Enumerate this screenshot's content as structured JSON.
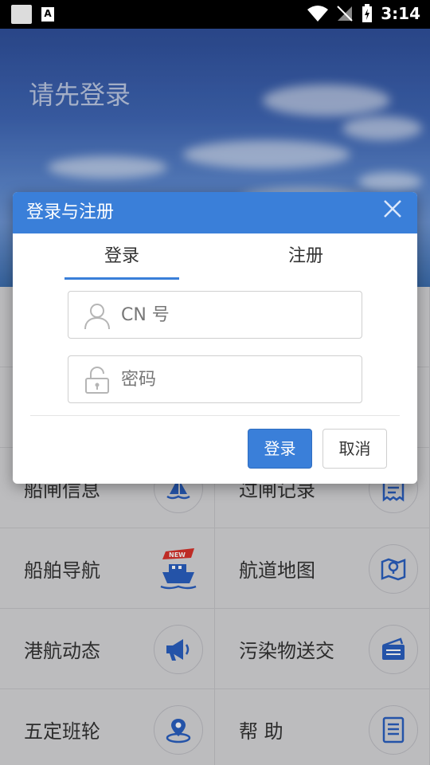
{
  "status_bar": {
    "time": "3:14"
  },
  "header": {
    "title": "请先登录"
  },
  "menu": [
    {
      "label": "",
      "icon": ""
    },
    {
      "label": "",
      "icon": ""
    },
    {
      "label": "",
      "icon": ""
    },
    {
      "label": "",
      "icon": ""
    },
    {
      "label": "船闸信息",
      "icon": "sailboat-icon"
    },
    {
      "label": "过闸记录",
      "icon": "receipt-icon"
    },
    {
      "label": "船舶导航",
      "icon": "ship-new-icon"
    },
    {
      "label": "航道地图",
      "icon": "map-pin-icon"
    },
    {
      "label": "港航动态",
      "icon": "megaphone-icon"
    },
    {
      "label": "污染物送交",
      "icon": "wallet-icon"
    },
    {
      "label": "五定班轮",
      "icon": "location-icon"
    },
    {
      "label": "帮 助",
      "icon": "document-icon"
    }
  ],
  "dialog": {
    "title": "登录与注册",
    "tabs": {
      "login": "登录",
      "register": "注册"
    },
    "username_placeholder": "CN 号",
    "password_placeholder": "密码",
    "login_button": "登录",
    "cancel_button": "取消"
  },
  "colors": {
    "accent": "#3a7fd9",
    "icon_blue": "#2a5fc0"
  }
}
